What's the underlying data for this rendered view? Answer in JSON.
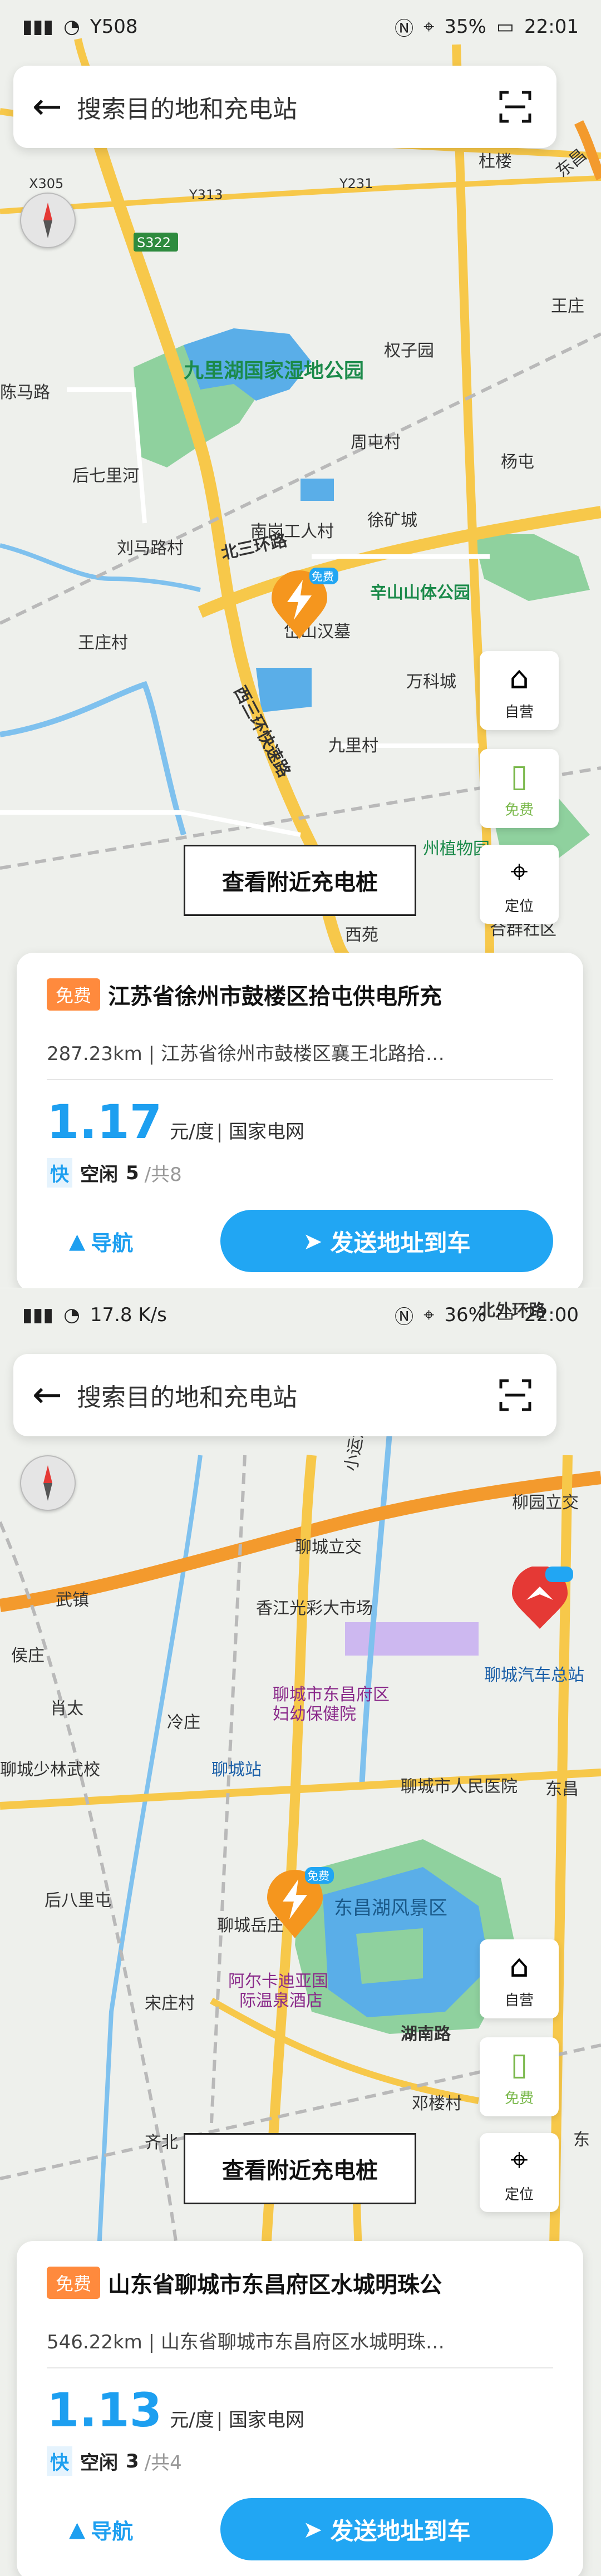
{
  "screen1": {
    "status": {
      "time": "22:01",
      "battery": "35%",
      "speed": "Y508"
    },
    "search": {
      "placeholder": "搜索目的地和充电站"
    },
    "side": {
      "palace": "自营",
      "free": "免费",
      "locate": "定位"
    },
    "nearby_label": "查看附近充电桩",
    "pin_badge": "免费",
    "map_labels": [
      "九里湖国家湿地公园",
      "权子园",
      "南岗工人村",
      "徐矿城",
      "辛山山体公园",
      "万科城",
      "九里村",
      "杨屯",
      "王庄",
      "周屯村",
      "后七里河",
      "刘马路村",
      "王庄村",
      "陈马路",
      "北三环路",
      "西三环快速路",
      "西苑",
      "合群社区",
      "杜楼",
      "东昌",
      "岱山汉墓",
      "州植物园",
      "Y313",
      "Y231",
      "S322",
      "X305",
      "X208"
    ],
    "card": {
      "tag": "免费",
      "title": "江苏省徐州市鼓楼区拾屯供电所充",
      "addr": "287.23km | 江苏省徐州市鼓楼区襄王北路拾…",
      "price": "1.17",
      "unit": "元/度",
      "operator": "| 国家电网",
      "fast": "快",
      "idle_label": "空闲",
      "idle": "5",
      "total": "/共8",
      "nav": "导航",
      "send": "发送地址到车"
    }
  },
  "screen2": {
    "status": {
      "time": "22:00",
      "battery": "36%",
      "speed": "17.8 K/s"
    },
    "search": {
      "placeholder": "搜索目的地和充电站"
    },
    "side": {
      "palace": "自营",
      "free": "免费",
      "locate": "定位"
    },
    "nearby_label": "查看附近充电桩",
    "pin_badge": "免费",
    "map_labels": [
      "聊城立交",
      "柳园立交",
      "香江光彩大市场",
      "聊城汽车总站",
      "聊城市东昌府区妇幼保健院",
      "聊城少林武校",
      "聊城站",
      "聊城市人民医院",
      "东昌湖风景区",
      "聊城岳庄",
      "阿尔卡迪亚国际温泉酒店",
      "宋庄村",
      "湖南路",
      "邓楼村",
      "齐北",
      "后八里屯",
      "肖太",
      "冷庄",
      "侯庄",
      "武镇",
      "东昌",
      "北外环路",
      "小运河",
      "东"
    ],
    "card": {
      "tag": "免费",
      "title": "山东省聊城市东昌府区水城明珠公",
      "addr": "546.22km | 山东省聊城市东昌府区水城明珠…",
      "price": "1.13",
      "unit": "元/度",
      "operator": "| 国家电网",
      "fast": "快",
      "idle_label": "空闲",
      "idle": "3",
      "total": "/共4",
      "nav": "导航",
      "send": "发送地址到车"
    }
  },
  "colors": {
    "accent": "#21a6f3",
    "tag": "#ff8a3d",
    "pin": "#f5961e",
    "road_major": "#f7c84a",
    "road_ring": "#f39a2d",
    "water": "#5aaee8",
    "park": "#8fd19e"
  }
}
